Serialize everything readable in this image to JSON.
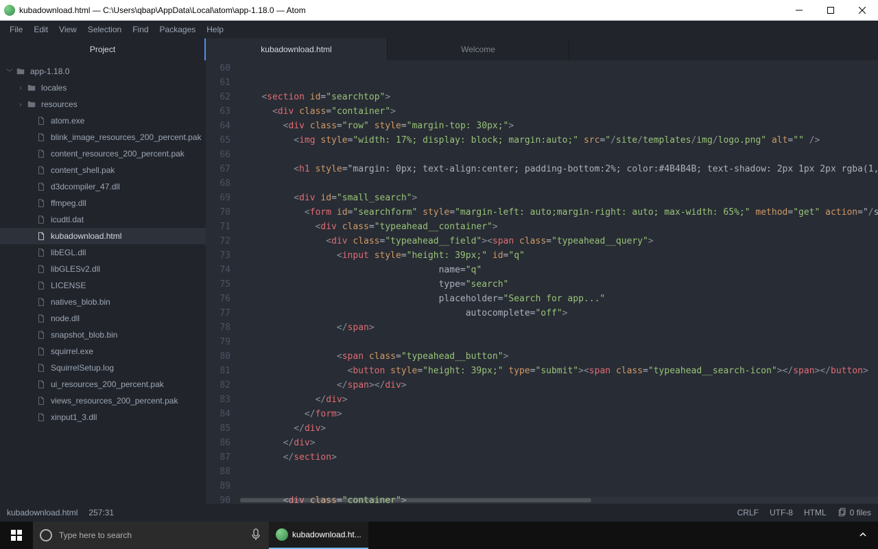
{
  "window": {
    "title": "kubadownload.html — C:\\Users\\qbap\\AppData\\Local\\atom\\app-1.18.0 — Atom"
  },
  "menus": [
    "File",
    "Edit",
    "View",
    "Selection",
    "Find",
    "Packages",
    "Help"
  ],
  "project_header": "Project",
  "tabs": [
    {
      "label": "kubadownload.html",
      "active": true
    },
    {
      "label": "Welcome",
      "active": false
    }
  ],
  "tree": {
    "root": "app-1.18.0",
    "folders": [
      "locales",
      "resources"
    ],
    "files": [
      "atom.exe",
      "blink_image_resources_200_percent.pak",
      "content_resources_200_percent.pak",
      "content_shell.pak",
      "d3dcompiler_47.dll",
      "ffmpeg.dll",
      "icudtl.dat",
      "kubadownload.html",
      "libEGL.dll",
      "libGLESv2.dll",
      "LICENSE",
      "natives_blob.bin",
      "node.dll",
      "snapshot_blob.bin",
      "squirrel.exe",
      "SquirrelSetup.log",
      "ui_resources_200_percent.pak",
      "views_resources_200_percent.pak",
      "xinput1_3.dll"
    ],
    "selected": "kubadownload.html"
  },
  "editor": {
    "first_line_number": 60,
    "code_lines": [
      "",
      "",
      "    <section id=\"searchtop\">",
      "      <div class=\"container\">",
      "        <div class=\"row\" style=\"margin-top: 30px;\">",
      "          <img style=\"width: 17%; display: block; margin:auto;\" src=\"/site/templates/img/logo.png\" alt=\"\" />",
      "",
      "          <h1 style=\"margin: 0px; text-align:center; padding-bottom:2%; color:#4B4B4B; text-shadow: 2px 1px 2px rgba(1, ",
      "",
      "          <div id=\"small_search\">",
      "            <form id=\"searchform\" style=\"margin-left: auto;margin-right: auto; max-width: 65%;\" method=\"get\" action=\"/se",
      "              <div class=\"typeahead__container\">",
      "                <div class=\"typeahead__field\"><span class=\"typeahead__query\">",
      "                  <input style=\"height: 39px;\" id=\"q\"",
      "                                     name=\"q\"",
      "                                     type=\"search\"",
      "                                     placeholder=\"Search for app...\"",
      "                                          autocomplete=\"off\">",
      "                  </span>",
      "",
      "                  <span class=\"typeahead__button\">",
      "                    <button style=\"height: 39px;\" type=\"submit\"><span class=\"typeahead__search-icon\"></span></button>",
      "                  </span></div>",
      "              </div>",
      "            </form>",
      "          </div>",
      "        </div>",
      "        </section>",
      "",
      "",
      "        <div class=\"container\">",
      ""
    ]
  },
  "status": {
    "file": "kubadownload.html",
    "position": "257:31",
    "eol": "CRLF",
    "encoding": "UTF-8",
    "lang": "HTML",
    "files_count": "0 files"
  },
  "taskbar": {
    "search_placeholder": "Type here to search",
    "task_label": "kubadownload.ht..."
  }
}
